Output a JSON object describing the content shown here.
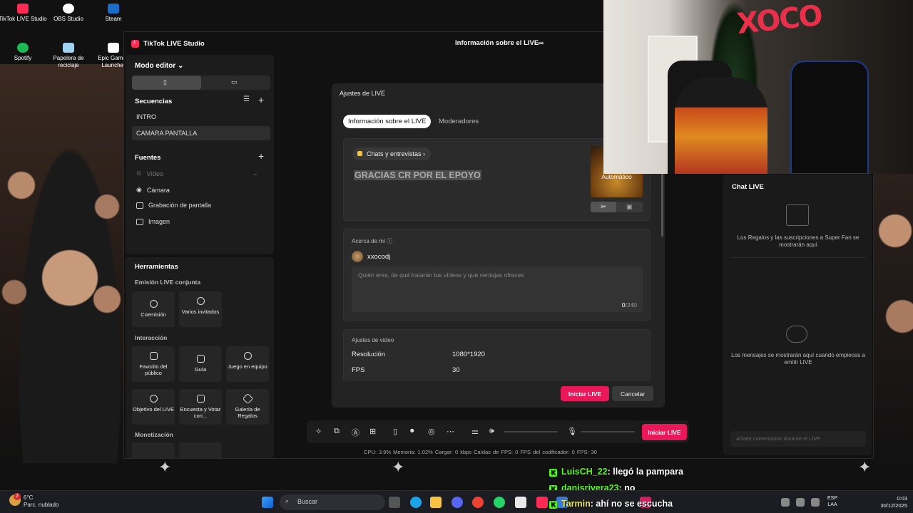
{
  "desktop": {
    "icons": [
      {
        "label": "TikTok LIVE Studio",
        "color": "#ff2b55"
      },
      {
        "label": "OBS Studio",
        "color": "#ffffff"
      },
      {
        "label": "Steam",
        "color": "#1b6bc9"
      },
      {
        "label": "Spotify",
        "color": "#1db954"
      },
      {
        "label": "Papelera de reciclaje",
        "color": "#9fd3f0"
      },
      {
        "label": "Epic Games Launcher",
        "color": "#ffffff"
      }
    ]
  },
  "studio": {
    "app_title": "TikTok LIVE Studio",
    "live_info_title": "Información sobre el LIVE",
    "editor_mode": "Modo editor",
    "sequences": {
      "title": "Secuencias",
      "items": [
        "INTRO",
        "CAMARA PANTALLA"
      ],
      "selected": 1
    },
    "sources": {
      "title": "Fuentes",
      "items": [
        "Vídeo",
        "Cámara",
        "Grabación de pantalla",
        "Imagen"
      ]
    },
    "tools": {
      "title": "Herramientas",
      "groups": [
        {
          "title": "Emisión LIVE conjunta",
          "items": [
            "Coemisión",
            "Varios invitados"
          ]
        },
        {
          "title": "Interacción",
          "items": [
            "Favorito del público",
            "Guía",
            "Juego en equipo",
            "Objetivo del LIVE",
            "Encuesta y Votar con...",
            "Galería de Regalos"
          ]
        },
        {
          "title": "Monetización",
          "items": []
        }
      ]
    },
    "go_live_button": "Iniciar LIVE",
    "stats": "CPU: 3.9%     Memoria: 1.02%     Cargar: 0 kbps     Caídas de FPS: 0     FPS del codificador: 0     FPS: 30",
    "chat": {
      "title": "Chat LIVE",
      "gifts_msg": "Los Regalos y las suscripciones a Super Fan se mostrarán aquí",
      "messages_msg": "Los mensajes se mostrarán aquí cuando empieces a emitir LIVE",
      "input_placeholder": "Añade comentarios durante el LIVE"
    }
  },
  "modal": {
    "title": "Ajustes de LIVE",
    "tabs": [
      "Información sobre el LIVE",
      "Moderadores"
    ],
    "active_tab": 0,
    "category": "Chats y entrevistas",
    "live_title": "GRACIAS CR POR EL EPOYO",
    "cover_label": "Automático",
    "about": {
      "label": "Acerca de mí",
      "username": "xxocodj",
      "placeholder": "Quién eres, de qué tratarán tus vídeos y qué ventajas ofreces",
      "count": "0",
      "max": "/240"
    },
    "video": {
      "label": "Ajustes de vídeo",
      "rows": [
        {
          "k": "Resolución",
          "v": "1080*1920"
        },
        {
          "k": "FPS",
          "v": "30"
        }
      ]
    },
    "start_button": "Iniciar LIVE",
    "cancel_button": "Cancelar"
  },
  "overlay_chat": [
    {
      "user": "LuisCH_22",
      "text": ": llegó la pampara"
    },
    {
      "user": "danisrivera23",
      "text": ": no"
    },
    {
      "user": "Tarmin",
      "text": ": ahí no se escucha"
    }
  ],
  "webcam": {
    "wall_text": "XOCO"
  },
  "taskbar": {
    "weather_temp": "6°C",
    "weather_desc": "Parc. nublado",
    "weather_badge": "2",
    "search_placeholder": "Buscar",
    "lang_top": "ESP",
    "lang_bottom": "LAA",
    "time": "0:03",
    "date": "30/12/2025"
  }
}
